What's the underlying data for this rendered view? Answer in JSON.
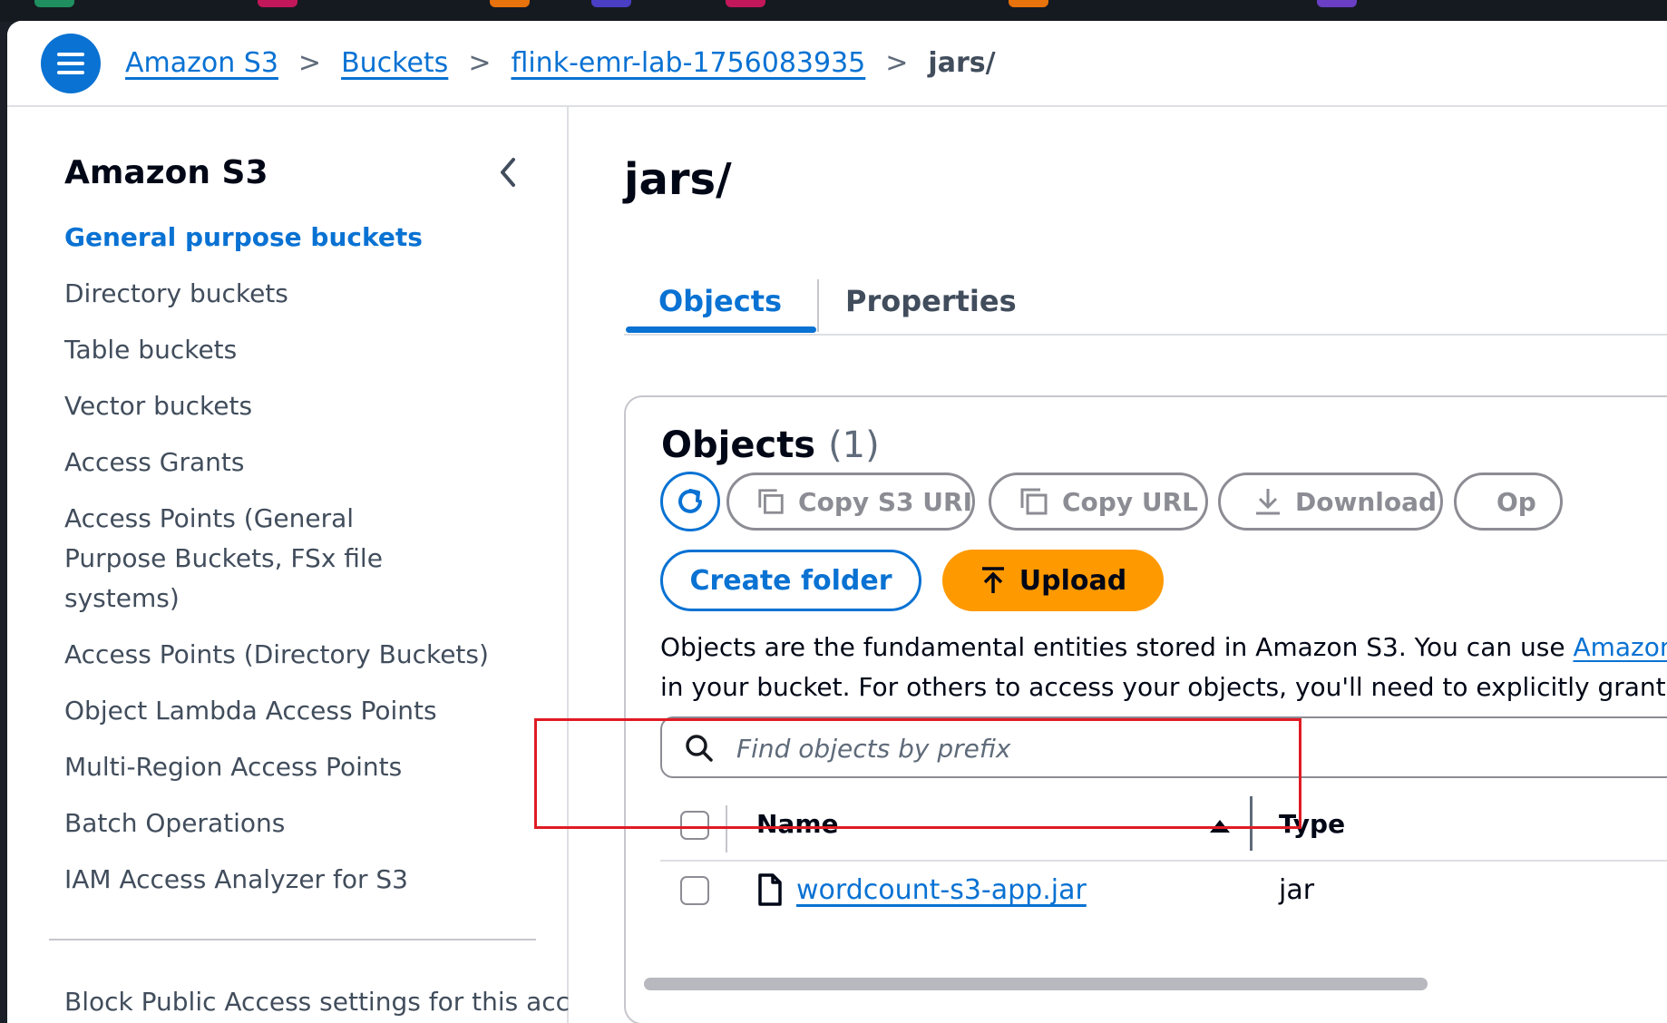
{
  "breadcrumb": {
    "items": [
      "Amazon S3",
      "Buckets",
      "flink-emr-lab-1756083935"
    ],
    "current": "jars/"
  },
  "sidebar": {
    "title": "Amazon S3",
    "items": [
      "General purpose buckets",
      "Directory buckets",
      "Table buckets",
      "Vector buckets",
      "Access Grants",
      "Access Points (General Purpose Buckets, FSx file systems)",
      "Access Points (Directory Buckets)",
      "Object Lambda Access Points",
      "Multi-Region Access Points",
      "Batch Operations",
      "IAM Access Analyzer for S3"
    ],
    "active_item": "General purpose buckets",
    "bottom_item": "Block Public Access settings for this account"
  },
  "page": {
    "title": "jars/",
    "tabs": [
      "Objects",
      "Properties"
    ],
    "active_tab": "Objects"
  },
  "objects": {
    "heading": "Objects",
    "count": "(1)",
    "actions": {
      "copy_s3_uri": "Copy S3 URI",
      "copy_url": "Copy URL",
      "download": "Download",
      "open": "Op",
      "create_folder": "Create folder",
      "upload": "Upload"
    },
    "description_line1": "Objects are the fundamental entities stored in Amazon S3. You can use ",
    "description_link": "Amazon",
    "description_line2": "in your bucket. For others to access your objects, you'll need to explicitly grant t",
    "search_placeholder": "Find objects by prefix",
    "columns": [
      "Name",
      "Type"
    ],
    "rows": [
      {
        "name": "wordcount-s3-app.jar",
        "type": "jar"
      }
    ]
  },
  "colors": {
    "link_blue": "#0972d3",
    "upload_orange": "#ff9900",
    "highlight_red": "#e01b24",
    "disabled_gray": "#8c8c94"
  },
  "icons": [
    "menu-icon",
    "chevron-right-icon",
    "chevron-left-icon",
    "refresh-icon",
    "copy-icon",
    "download-icon",
    "upload-icon",
    "search-icon",
    "sort-ascending-icon",
    "file-icon"
  ]
}
